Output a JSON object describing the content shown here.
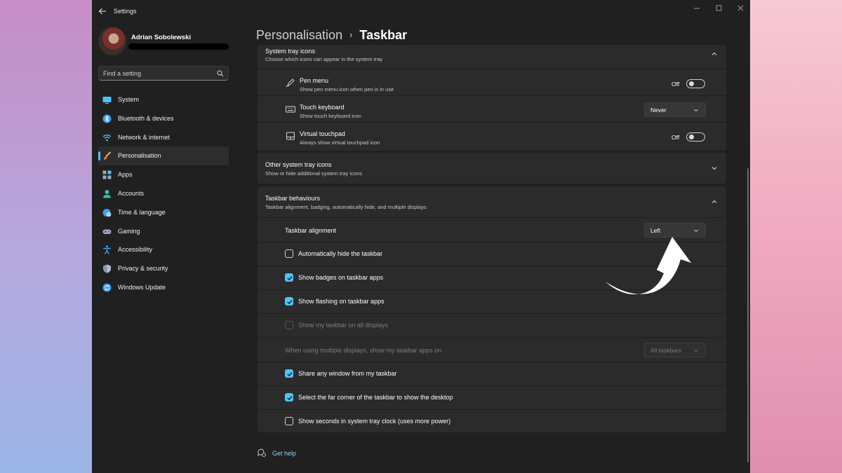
{
  "window": {
    "title": "Settings"
  },
  "profile": {
    "name": "Adrian Sobolewski"
  },
  "search": {
    "placeholder": "Find a setting"
  },
  "sidebar": {
    "items": [
      {
        "label": "System",
        "icon": "monitor-icon"
      },
      {
        "label": "Bluetooth & devices",
        "icon": "bluetooth-icon"
      },
      {
        "label": "Network & internet",
        "icon": "wifi-icon"
      },
      {
        "label": "Personalisation",
        "icon": "brush-icon",
        "active": true
      },
      {
        "label": "Apps",
        "icon": "apps-icon"
      },
      {
        "label": "Accounts",
        "icon": "person-icon"
      },
      {
        "label": "Time & language",
        "icon": "globe-clock-icon"
      },
      {
        "label": "Gaming",
        "icon": "gamepad-icon"
      },
      {
        "label": "Accessibility",
        "icon": "accessibility-icon"
      },
      {
        "label": "Privacy & security",
        "icon": "shield-icon"
      },
      {
        "label": "Windows Update",
        "icon": "update-icon"
      }
    ]
  },
  "breadcrumb": {
    "parent": "Personalisation",
    "separator": "›",
    "current": "Taskbar"
  },
  "tray": {
    "title": "System tray icons",
    "desc": "Choose which icons can appear in the system tray",
    "items": [
      {
        "title": "Pen menu",
        "desc": "Show pen menu icon when pen is in use",
        "control": "toggle",
        "value": "Off",
        "icon": "pen-icon"
      },
      {
        "title": "Touch keyboard",
        "desc": "Show touch keyboard icon",
        "control": "dropdown",
        "value": "Never",
        "icon": "keyboard-icon"
      },
      {
        "title": "Virtual touchpad",
        "desc": "Always show virtual touchpad icon",
        "control": "toggle",
        "value": "Off",
        "icon": "touchpad-icon"
      }
    ]
  },
  "other_tray": {
    "title": "Other system tray icons",
    "desc": "Show or hide additional system tray icons"
  },
  "behaviours": {
    "title": "Taskbar behaviours",
    "desc": "Taskbar alignment, badging, automatically hide, and multiple displays",
    "alignment_label": "Taskbar alignment",
    "alignment_value": "Left",
    "checks": [
      {
        "label": "Automatically hide the taskbar",
        "checked": false,
        "disabled": false
      },
      {
        "label": "Show badges on taskbar apps",
        "checked": true,
        "disabled": false
      },
      {
        "label": "Show flashing on taskbar apps",
        "checked": true,
        "disabled": false
      },
      {
        "label": "Show my taskbar on all displays",
        "checked": false,
        "disabled": true
      }
    ],
    "multi_label": "When using multiple displays, show my taskbar apps on",
    "multi_value": "All taskbars",
    "checks2": [
      {
        "label": "Share any window from my taskbar",
        "checked": true,
        "disabled": false
      },
      {
        "label": "Select the far corner of the taskbar to show the desktop",
        "checked": true,
        "disabled": false
      },
      {
        "label": "Show seconds in system tray clock (uses more power)",
        "checked": false,
        "disabled": false
      }
    ]
  },
  "help": {
    "label": "Get help"
  },
  "colors": {
    "accent": "#4cc2ff",
    "window_bg": "#202020",
    "card_bg": "#2b2b2b"
  }
}
